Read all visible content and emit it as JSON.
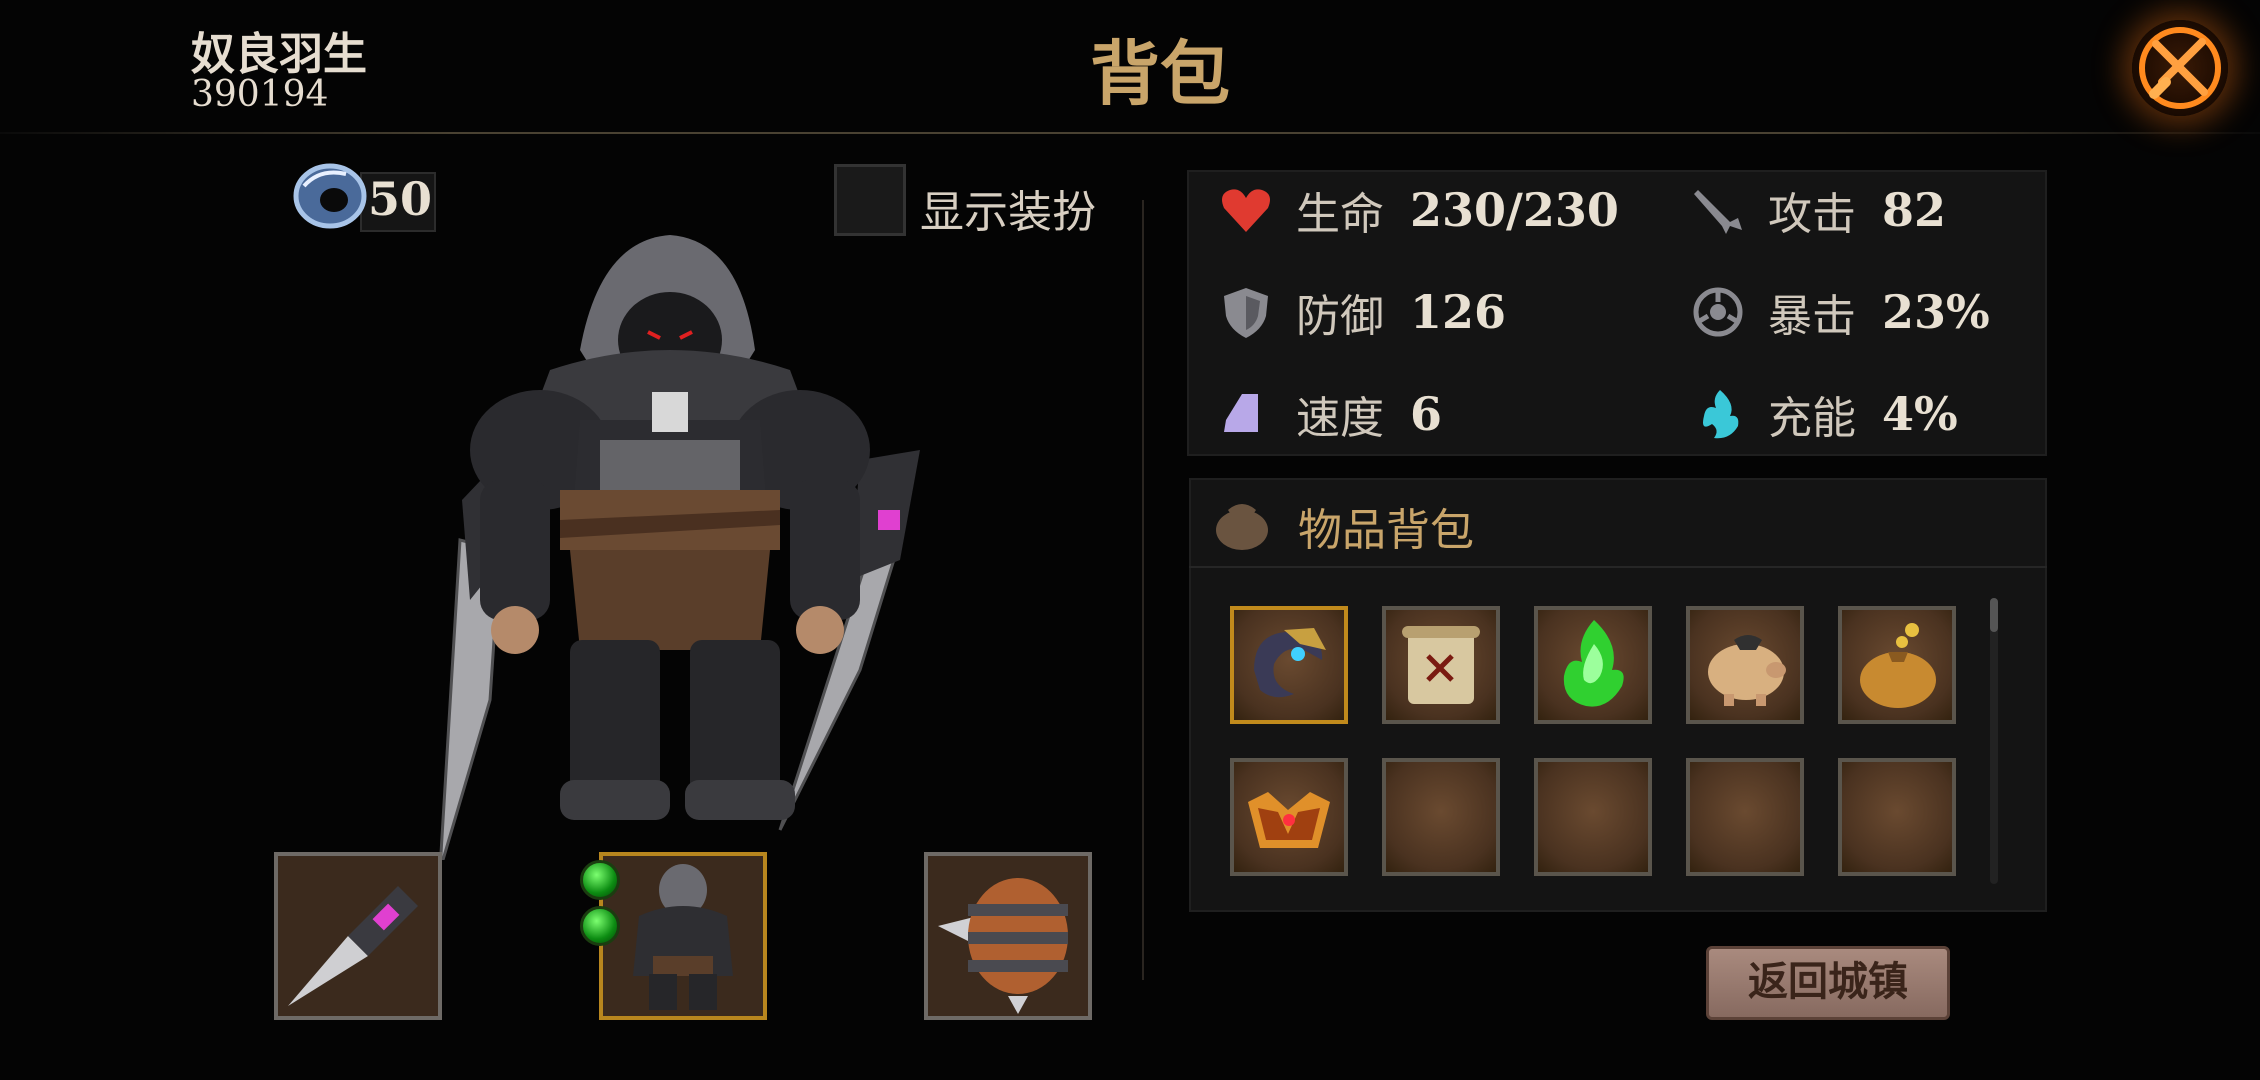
{
  "header": {
    "player_name": "奴良羽生",
    "player_id": "390194",
    "title": "背包"
  },
  "currency": {
    "icon": "ring-currency-icon",
    "value": "50"
  },
  "outfit": {
    "label": "显示装扮",
    "checked": false
  },
  "stats": {
    "hp": {
      "label": "生命",
      "value": "230/230",
      "icon": "heart-icon",
      "color": "#e03a30"
    },
    "attack": {
      "label": "攻击",
      "value": "82",
      "icon": "sword-icon"
    },
    "defense": {
      "label": "防御",
      "value": "126",
      "icon": "shield-icon"
    },
    "crit": {
      "label": "暴击",
      "value": "23%",
      "icon": "crit-icon"
    },
    "speed": {
      "label": "速度",
      "value": "6",
      "icon": "boot-icon",
      "color": "#b8a8e8"
    },
    "charge": {
      "label": "充能",
      "value": "4%",
      "icon": "flame-icon",
      "color": "#3ac8d8"
    }
  },
  "bag": {
    "title": "物品背包",
    "items": [
      {
        "name": "amulet-item",
        "icon": "amulet-icon",
        "frame": "gold"
      },
      {
        "name": "scroll-item",
        "icon": "scroll-icon",
        "frame": "silver"
      },
      {
        "name": "green-essence-item",
        "icon": "green-flame-icon",
        "frame": "silver"
      },
      {
        "name": "piggy-bank-item",
        "icon": "pig-icon",
        "frame": "silver"
      },
      {
        "name": "gold-pouch-item",
        "icon": "pouch-icon",
        "frame": "silver"
      },
      {
        "name": "crown-item",
        "icon": "crown-icon",
        "frame": "silver"
      },
      {
        "name": "empty",
        "icon": "",
        "frame": "silver"
      },
      {
        "name": "empty",
        "icon": "",
        "frame": "silver"
      },
      {
        "name": "empty",
        "icon": "",
        "frame": "silver"
      },
      {
        "name": "empty",
        "icon": "",
        "frame": "silver"
      }
    ]
  },
  "equipment": {
    "weapon": {
      "icon": "blade-icon",
      "frame": "silver"
    },
    "armor": {
      "icon": "armor-icon",
      "frame": "gold",
      "gems": 2
    },
    "accessory": {
      "icon": "spiked-orb-icon",
      "frame": "silver"
    }
  },
  "return_button": {
    "label": "返回城镇"
  }
}
